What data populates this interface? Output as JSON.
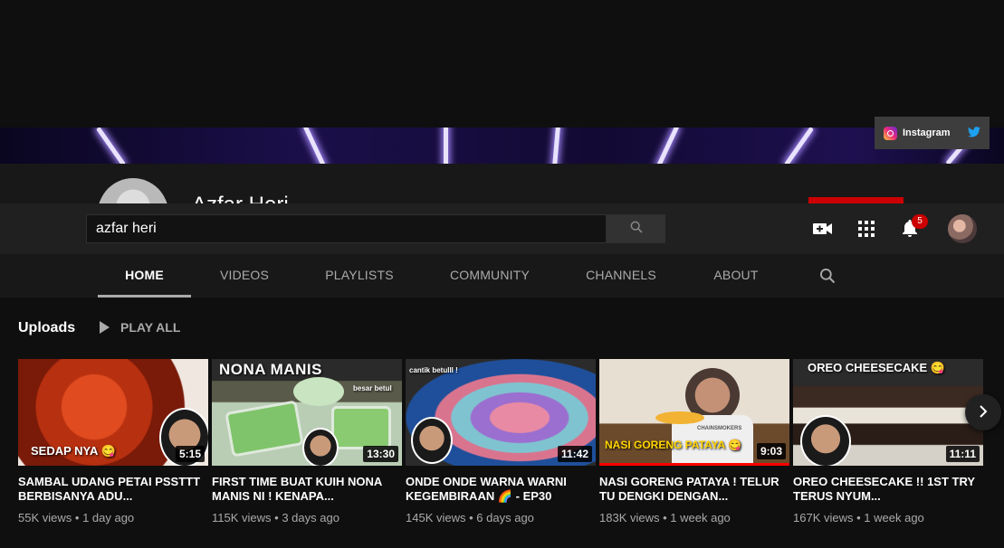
{
  "social": {
    "instagram_label": "Instagram",
    "twitter_icon": "twitter-icon"
  },
  "channel": {
    "name": "Azfar Heri"
  },
  "search": {
    "value": "azfar heri"
  },
  "notifications": {
    "count": "5"
  },
  "tabs": [
    {
      "label": "HOME"
    },
    {
      "label": "VIDEOS"
    },
    {
      "label": "PLAYLISTS"
    },
    {
      "label": "COMMUNITY"
    },
    {
      "label": "CHANNELS"
    },
    {
      "label": "ABOUT"
    }
  ],
  "uploads": {
    "title": "Uploads",
    "play_all": "PLAY ALL"
  },
  "videos": [
    {
      "overlay": "SEDAP NYA 😋",
      "duration": "5:15",
      "title": "SAMBAL UDANG PETAI PSSTTT BERBISANYA ADU...",
      "views": "55K views",
      "age": "1 day ago"
    },
    {
      "overlay": "NONA MANIS",
      "overlay2": "besar betul",
      "duration": "13:30",
      "title": "FIRST TIME BUAT KUIH NONA MANIS NI ! KENAPA...",
      "views": "115K views",
      "age": "3 days ago"
    },
    {
      "overlay": "cantik betulll !",
      "duration": "11:42",
      "title": "ONDE ONDE WARNA WARNI KEGEMBIRAAN 🌈 - EP30",
      "views": "145K views",
      "age": "6 days ago"
    },
    {
      "overlay": "NASI GORENG PATAYA 😋",
      "overlay2": "CHAINSMOKERS",
      "duration": "9:03",
      "title": "NASI GORENG PATAYA ! TELUR TU DENGKI DENGAN...",
      "views": "183K views",
      "age": "1 week ago"
    },
    {
      "overlay": "OREO CHEESECAKE 😋",
      "duration": "11:11",
      "title": "OREO CHEESECAKE !! 1ST TRY TERUS NYUM...",
      "views": "167K views",
      "age": "1 week ago"
    }
  ],
  "meta_separator": "•"
}
